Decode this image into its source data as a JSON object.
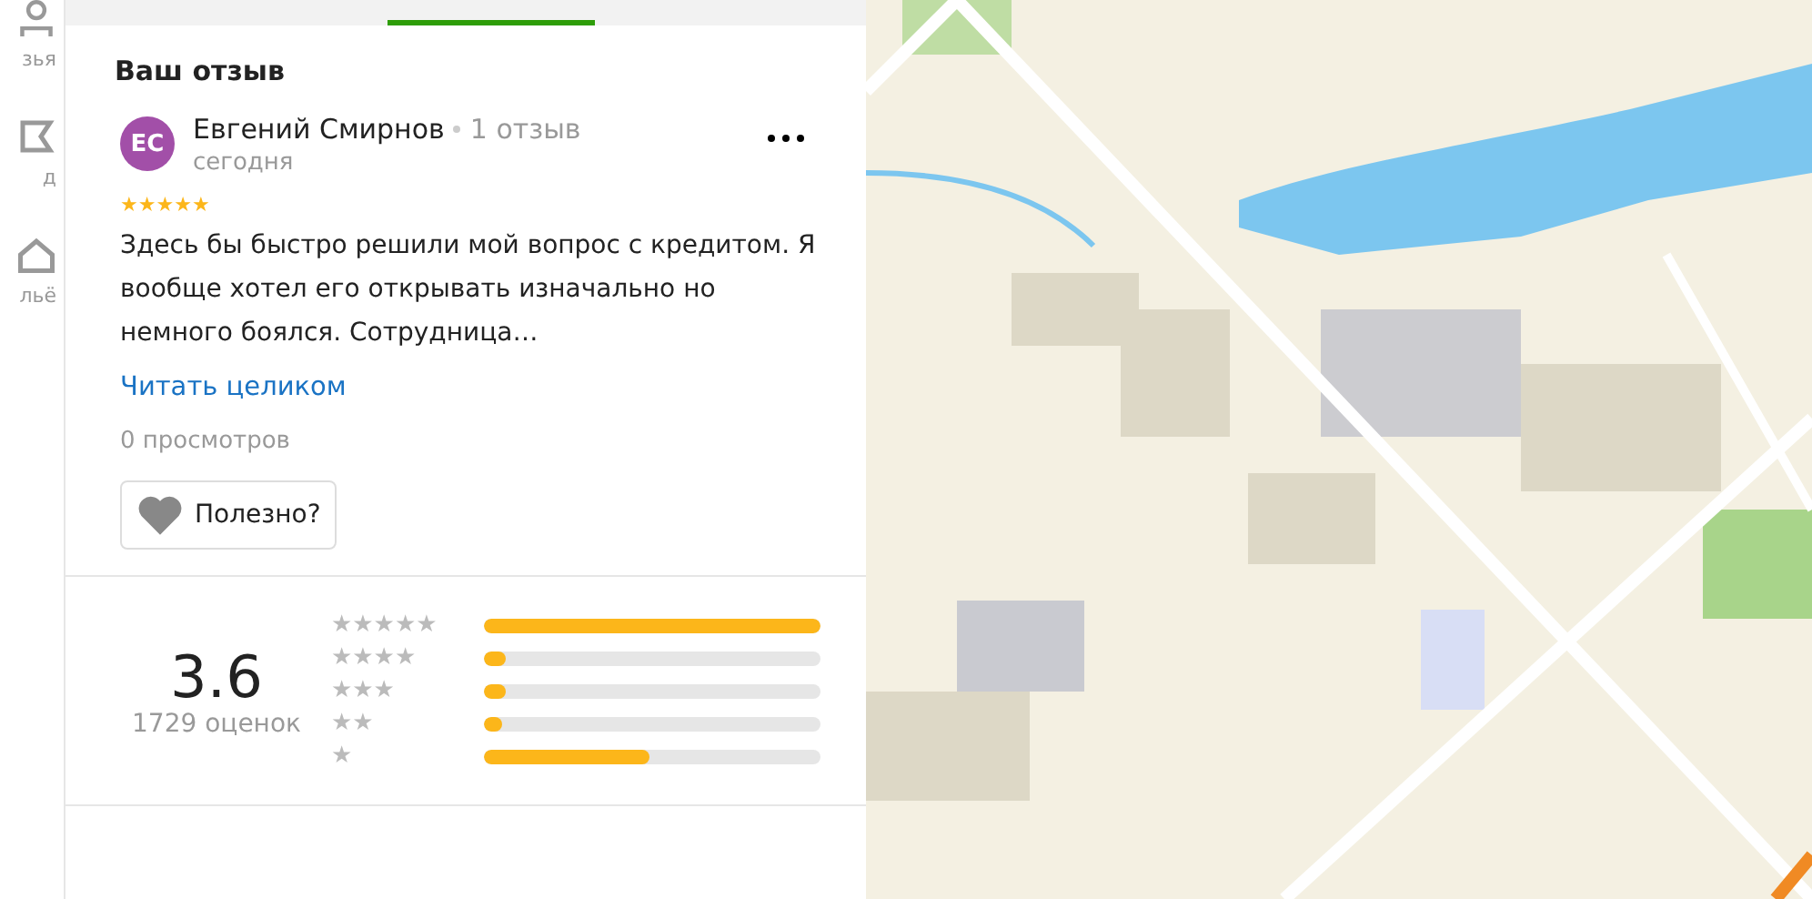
{
  "sidebar": {
    "items": [
      {
        "label": "зья"
      },
      {
        "label": "д"
      },
      {
        "label": "льё"
      }
    ]
  },
  "tab_bar": {
    "tabs": [
      {
        "selected": false
      },
      {
        "selected": true
      },
      {
        "selected": false
      }
    ]
  },
  "review": {
    "heading": "Ваш отзыв",
    "author": {
      "initials": "ЕС",
      "name": "Евгений Смирнов",
      "review_count": "1 отзыв",
      "date": "сегодня",
      "color": "#a24fa8"
    },
    "stars": 5,
    "text": "Здесь бы быстро решили мой вопрос с кредитом. Я вообще хотел его открывать изначально но немного боялся. Сотрудница…",
    "read_more": "Читать целиком",
    "views": "0 просмотров",
    "helpful_button": "Полезно?"
  },
  "rating_summary": {
    "score": "3.6",
    "count": "1729 оценок",
    "rows": [
      {
        "label": "★★★★★",
        "level": 1.0
      },
      {
        "label": "★★★★",
        "level": 0.065
      },
      {
        "label": "★★★",
        "level": 0.065
      },
      {
        "label": "★★",
        "level": 0.055
      },
      {
        "label": "★",
        "level": 0.49
      }
    ]
  }
}
